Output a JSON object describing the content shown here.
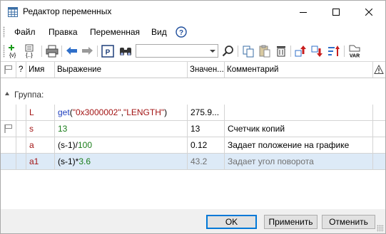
{
  "window": {
    "title": "Редактор переменных",
    "icon": "table-grid-icon"
  },
  "menu": {
    "items": [
      "Файл",
      "Правка",
      "Переменная",
      "Вид"
    ],
    "help_icon": "help-circle-icon"
  },
  "toolbar": {
    "search_value": "",
    "icons": [
      "add-variable-icon",
      "variable-list-icon",
      "print-icon",
      "undo-icon",
      "redo-icon",
      "parameters-icon",
      "binoculars-icon",
      "search-icon",
      "copy-icon",
      "paste-icon",
      "delete-icon",
      "move-up-icon",
      "move-down-icon",
      "sort-icon",
      "variable-icon"
    ]
  },
  "table": {
    "columns": {
      "flag": "",
      "q": "?",
      "name": "Имя",
      "expr": "Выражение",
      "value": "Значен...",
      "comment": "Комментарий"
    },
    "group_label": "Группа:",
    "rows": [
      {
        "flag": false,
        "name": "L",
        "expr_parts": [
          {
            "text": "get",
            "kind": "func"
          },
          {
            "text": "(",
            "kind": "plain"
          },
          {
            "text": "\"0x3000002\"",
            "kind": "str"
          },
          {
            "text": ",",
            "kind": "plain"
          },
          {
            "text": "\"LENGTH\"",
            "kind": "str"
          },
          {
            "text": ")",
            "kind": "plain"
          }
        ],
        "value": "275.9...",
        "comment": ""
      },
      {
        "flag": true,
        "name": "s",
        "expr_parts": [
          {
            "text": "13",
            "kind": "num"
          }
        ],
        "value": "13",
        "comment": "Счетчик копий"
      },
      {
        "flag": false,
        "name": "a",
        "expr_parts": [
          {
            "text": "(s-1)/",
            "kind": "plain"
          },
          {
            "text": "100",
            "kind": "num"
          }
        ],
        "value": "0.12",
        "comment": "Задает положение на графике"
      },
      {
        "flag": false,
        "name": "a1",
        "expr_parts": [
          {
            "text": "(s-1)*",
            "kind": "plain"
          },
          {
            "text": "3.6",
            "kind": "num"
          }
        ],
        "value": "43.2",
        "comment": "Задает угол поворота",
        "selected": true
      }
    ]
  },
  "buttons": {
    "ok": "OK",
    "apply": "Применить",
    "cancel": "Отменить"
  },
  "colors": {
    "accent": "#0078d7",
    "selection": "#ddeaf7",
    "name_red": "#a31515",
    "name_green": "#1a7d1a",
    "func_blue": "#1f3fbf"
  }
}
